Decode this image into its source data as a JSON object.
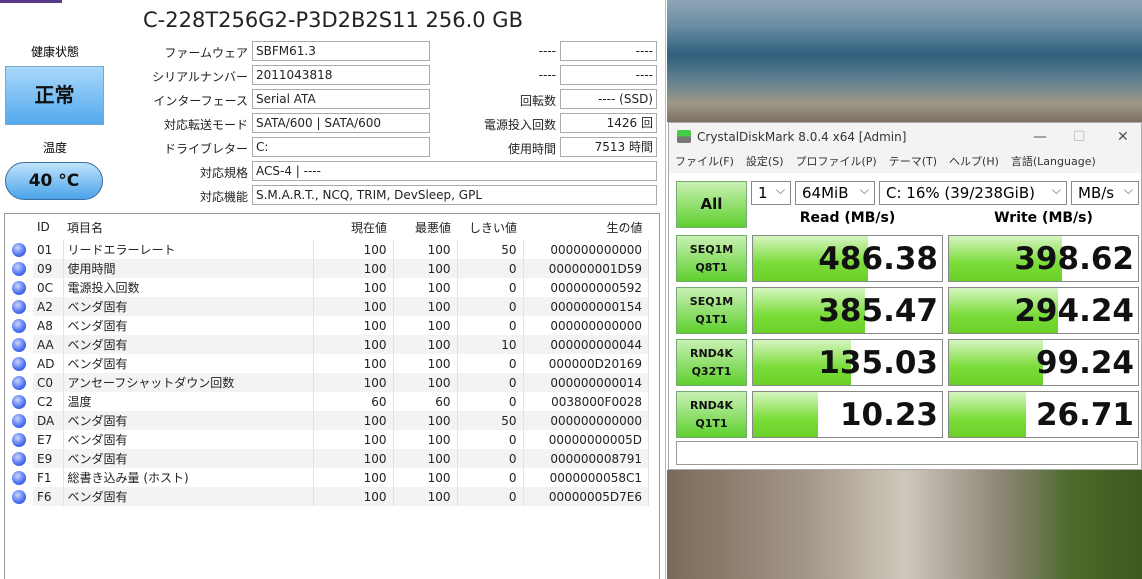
{
  "diskinfo": {
    "title": "C-228T256G2-P3D2B2S11 256.0 GB",
    "health_label": "健康状態",
    "health": "正常",
    "temp_label": "温度",
    "temp": "40 °C",
    "fields": [
      {
        "label": "ファームウェア",
        "value": "SBFM61.3"
      },
      {
        "label": "シリアルナンバー",
        "value": "2011043818"
      },
      {
        "label": "インターフェース",
        "value": "Serial ATA"
      },
      {
        "label": "対応転送モード",
        "value": "SATA/600 | SATA/600"
      },
      {
        "label": "ドライブレター",
        "value": "C:"
      },
      {
        "label": "対応規格",
        "value": "ACS-4 | ----"
      },
      {
        "label": "対応機能",
        "value": "S.M.A.R.T., NCQ, TRIM, DevSleep, GPL"
      }
    ],
    "right_fields": [
      {
        "label": "----",
        "value": "----"
      },
      {
        "label": "----",
        "value": "----"
      },
      {
        "label": "回転数",
        "value": "---- (SSD)"
      },
      {
        "label": "電源投入回数",
        "value": "1426 回"
      },
      {
        "label": "使用時間",
        "value": "7513 時間"
      }
    ],
    "columns": [
      "ID",
      "項目名",
      "現在値",
      "最悪値",
      "しきい値",
      "生の値"
    ],
    "rows": [
      [
        "01",
        "リードエラーレート",
        "100",
        "100",
        "50",
        "000000000000"
      ],
      [
        "09",
        "使用時間",
        "100",
        "100",
        "0",
        "000000001D59"
      ],
      [
        "0C",
        "電源投入回数",
        "100",
        "100",
        "0",
        "000000000592"
      ],
      [
        "A2",
        "ベンダ固有",
        "100",
        "100",
        "0",
        "000000000154"
      ],
      [
        "A8",
        "ベンダ固有",
        "100",
        "100",
        "0",
        "000000000000"
      ],
      [
        "AA",
        "ベンダ固有",
        "100",
        "100",
        "10",
        "000000000044"
      ],
      [
        "AD",
        "ベンダ固有",
        "100",
        "100",
        "0",
        "000000D20169"
      ],
      [
        "C0",
        "アンセーフシャットダウン回数",
        "100",
        "100",
        "0",
        "000000000014"
      ],
      [
        "C2",
        "温度",
        "60",
        "60",
        "0",
        "0038000F0028"
      ],
      [
        "DA",
        "ベンダ固有",
        "100",
        "100",
        "50",
        "000000000000"
      ],
      [
        "E7",
        "ベンダ固有",
        "100",
        "100",
        "0",
        "00000000005D"
      ],
      [
        "E9",
        "ベンダ固有",
        "100",
        "100",
        "0",
        "000000008791"
      ],
      [
        "F1",
        "総書き込み量 (ホスト)",
        "100",
        "100",
        "0",
        "0000000058C1"
      ],
      [
        "F6",
        "ベンダ固有",
        "100",
        "100",
        "0",
        "00000005D7E6"
      ]
    ]
  },
  "cdm": {
    "title": "CrystalDiskMark 8.0.4 x64 [Admin]",
    "menu": [
      "ファイル(F)",
      "設定(S)",
      "プロファイル(P)",
      "テーマ(T)",
      "ヘルプ(H)",
      "言語(Language)"
    ],
    "all_label": "All",
    "count": "1",
    "size": "64MiB",
    "drive": "C: 16% (39/238GiB)",
    "unit": "MB/s",
    "read_header": "Read (MB/s)",
    "write_header": "Write (MB/s)",
    "tests": [
      {
        "l1": "SEQ1M",
        "l2": "Q8T1",
        "read": "486.38",
        "write": "398.62"
      },
      {
        "l1": "SEQ1M",
        "l2": "Q1T1",
        "read": "385.47",
        "write": "294.24"
      },
      {
        "l1": "RND4K",
        "l2": "Q32T1",
        "read": "135.03",
        "write": "99.24"
      },
      {
        "l1": "RND4K",
        "l2": "Q1T1",
        "read": "10.23",
        "write": "26.71"
      }
    ],
    "colors": {
      "accent": "#6ad028"
    }
  }
}
